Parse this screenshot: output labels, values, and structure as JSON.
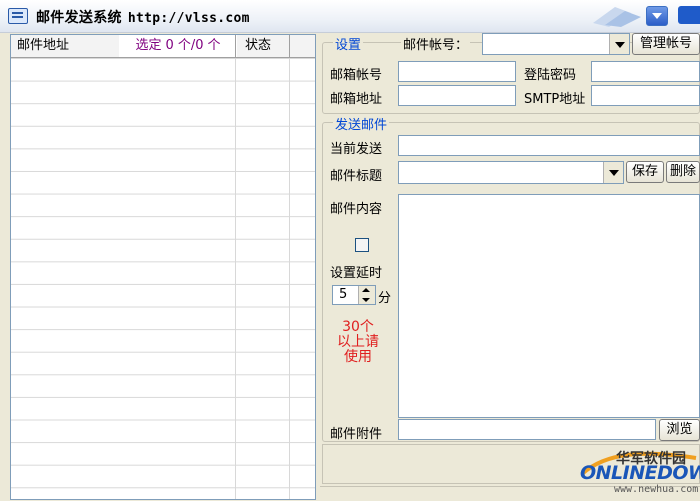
{
  "window": {
    "title": "邮件发送系统",
    "url": "http://vlss.com"
  },
  "list": {
    "col_address": "邮件地址",
    "selected_label": "选定",
    "selected_count": "0",
    "total_label": "个/0",
    "unit": "个",
    "col_status": "状态"
  },
  "settings": {
    "legend": "设置",
    "account_selector_label": "邮件帐号：",
    "account_selector_value": "",
    "manage_button": "管理帐号",
    "mailbox_account_label": "邮箱帐号",
    "login_password_label": "登陆密码",
    "mailbox_address_label": "邮箱地址",
    "smtp_label": "SMTP地址"
  },
  "send": {
    "legend": "发送邮件",
    "current_label": "当前发送",
    "subject_label": "邮件标题",
    "save_button": "保存",
    "delete_button": "删除",
    "content_label": "邮件内容",
    "delay_label": "设置延时",
    "delay_value": "5",
    "delay_unit": "分",
    "warning": "30个以上请使用",
    "attachment_label": "邮件附件",
    "browse_button": "浏览"
  },
  "watermark": {
    "cn": "华军软件园",
    "en": "ONLINEDOWN",
    "www": "www.newhua.com"
  },
  "colors": {
    "legend": "#0046d5",
    "warning": "#e02020",
    "selected": "#800080"
  }
}
